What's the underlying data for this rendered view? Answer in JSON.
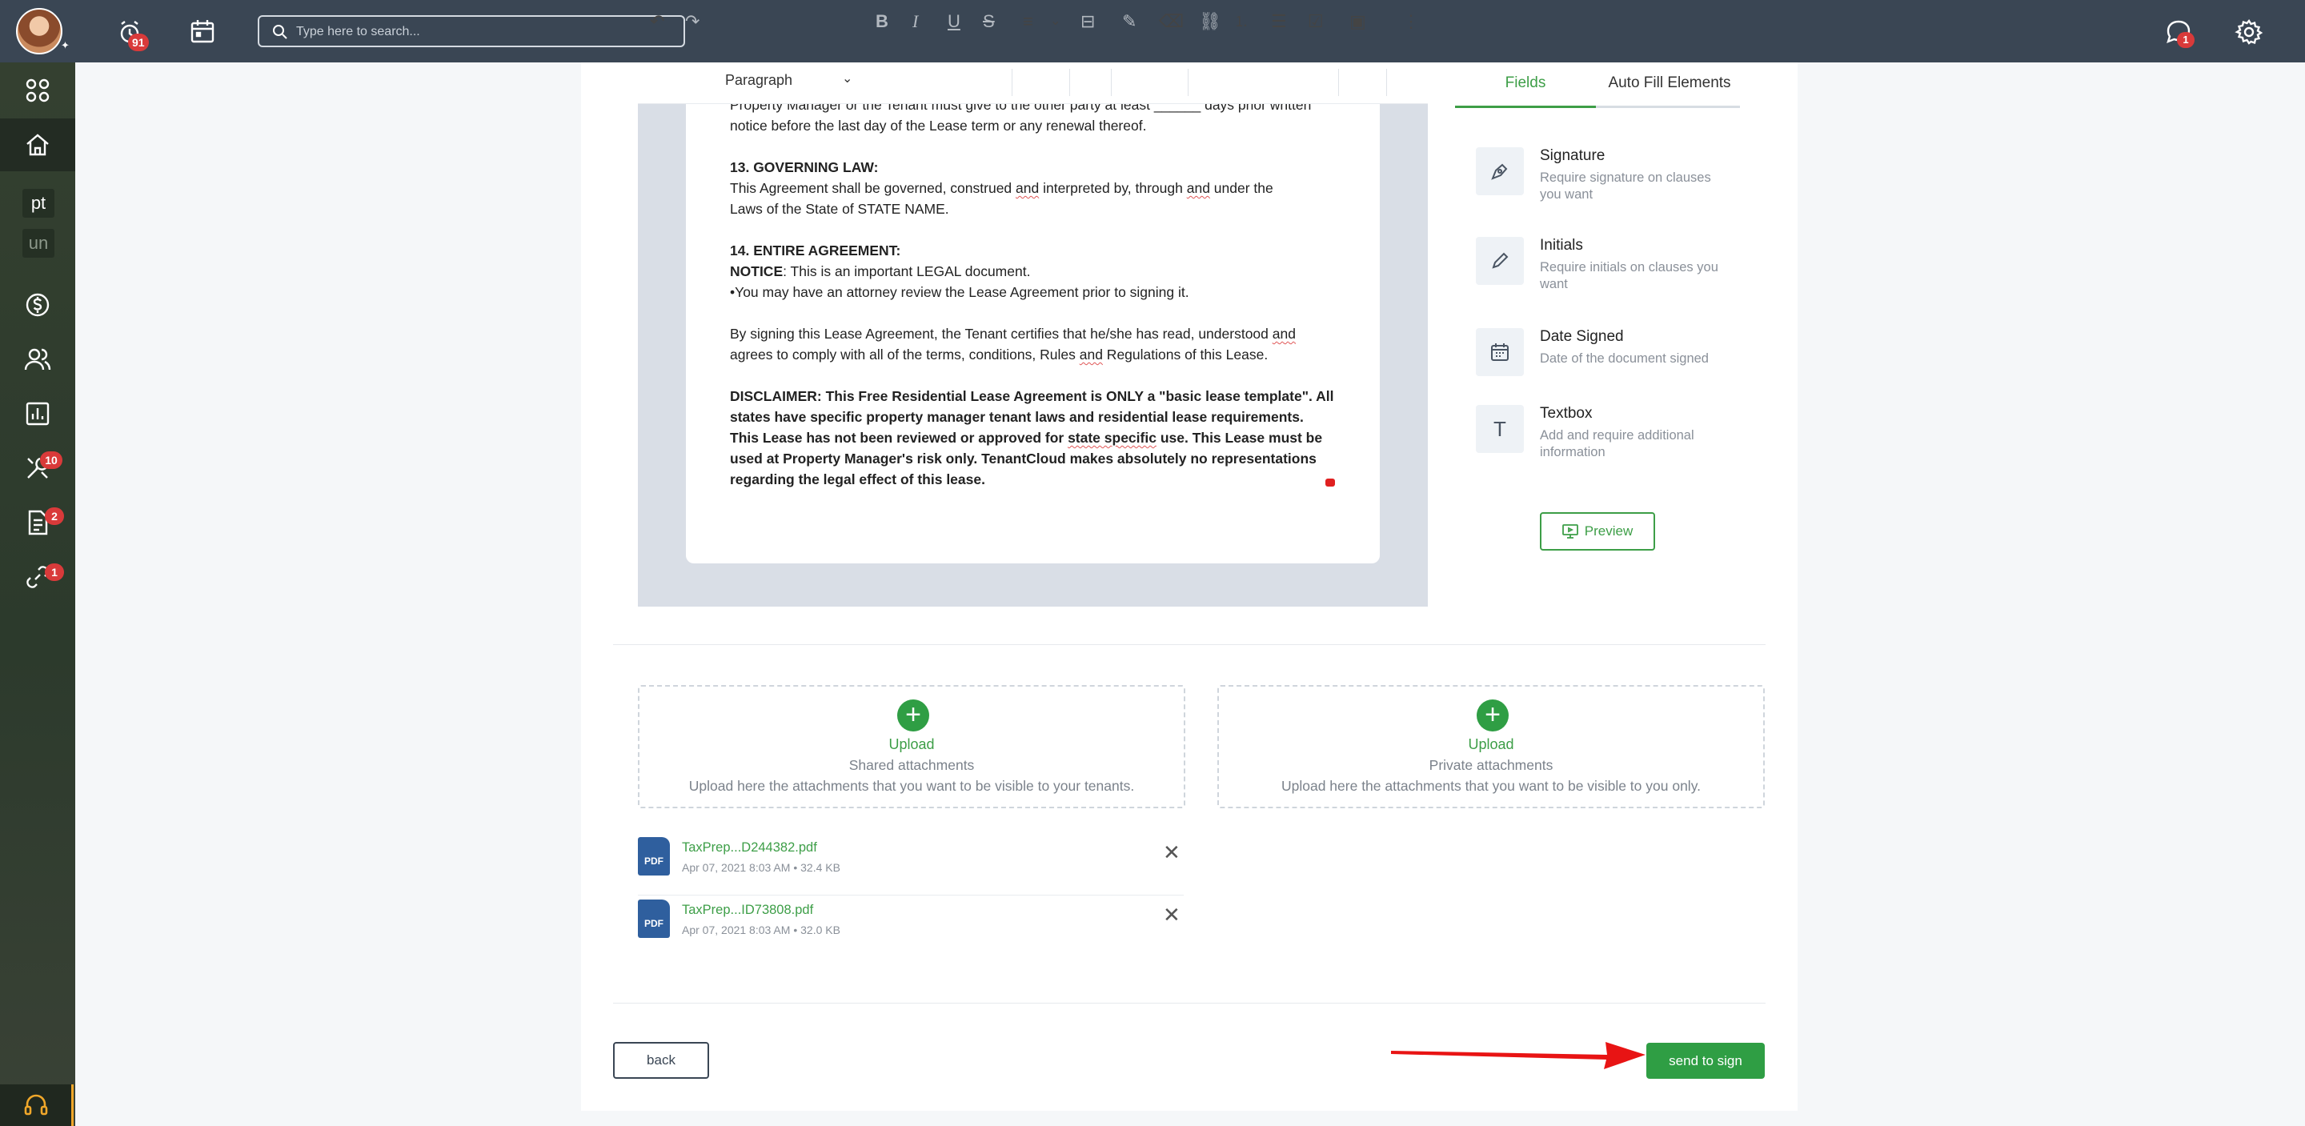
{
  "header": {
    "search_placeholder": "Type here to search...",
    "notifications_badge": "91",
    "messages_badge": "1"
  },
  "sidebar": {
    "tags": [
      "pt",
      "un"
    ],
    "maintenance_badge": "10",
    "applications_badge": "2",
    "links_badge": "1"
  },
  "toolbar": {
    "paragraph_style": "Paragraph"
  },
  "document": {
    "line_top": "Property Manager or the Tenant must give to the other party at least ______ days prior written",
    "line_top2": "notice before the last day of the Lease term or any renewal thereof.",
    "s13_heading": "13. GOVERNING LAW:",
    "s13_l1_a": "This Agreement shall be governed, construed ",
    "s13_and1": "and",
    "s13_l1_b": " interpreted by, through ",
    "s13_and2": "and",
    "s13_l1_c": " under the",
    "s13_l2": "Laws of the State of STATE NAME.",
    "s14_heading": "14. ENTIRE AGREEMENT:",
    "notice_label": "NOTICE",
    "notice_text": ": This is an important LEGAL document.",
    "attorney_line": "•You may have an attorney review the Lease Agreement prior to signing it.",
    "signing_l1_a": "By signing this Lease Agreement, the Tenant certifies that he/she has read, understood ",
    "signing_and": "and",
    "signing_l2_a": "agrees to comply with all of the terms, conditions, Rules ",
    "signing_and2": "and",
    "signing_l2_b": " Regulations of this Lease.",
    "disclaimer_l1": "DISCLAIMER: This Free Residential Lease Agreement is ONLY a \"basic lease template\". All",
    "disclaimer_l2": "states have specific property manager tenant laws and residential lease requirements.",
    "disclaimer_l3_a": "This Lease has not been reviewed or approved for ",
    "disclaimer_l3_sq": "state specific",
    "disclaimer_l3_b": " use. This Lease must be",
    "disclaimer_l4": "used at Property Manager's risk only. TenantCloud makes absolutely no representations",
    "disclaimer_l5": "regarding the legal effect of this lease."
  },
  "fields_panel": {
    "tabs": [
      "Fields",
      "Auto Fill Elements"
    ],
    "items": [
      {
        "title": "Signature",
        "desc": "Require signature on clauses you want",
        "icon": "pen-nib-icon"
      },
      {
        "title": "Initials",
        "desc": "Require initials on clauses you want",
        "icon": "pencil-icon"
      },
      {
        "title": "Date Signed",
        "desc": "Date of the document signed",
        "icon": "calendar-icon"
      },
      {
        "title": "Textbox",
        "desc": "Add and require additional information",
        "icon": "text-t-icon"
      }
    ],
    "preview_label": "Preview"
  },
  "uploads": [
    {
      "title": "Upload",
      "kind": "Shared attachments",
      "desc": "Upload here the attachments that you want to be visible to your tenants."
    },
    {
      "title": "Upload",
      "kind": "Private attachments",
      "desc": "Upload here the attachments that you want to be visible to you only."
    }
  ],
  "files": [
    {
      "name": "TaxPrep...D244382.pdf",
      "date": "Apr 07, 2021 8:03 AM",
      "size": "32.4 KB",
      "icon_label": "PDF"
    },
    {
      "name": "TaxPrep...ID73808.pdf",
      "date": "Apr 07, 2021 8:03 AM",
      "size": "32.0 KB",
      "icon_label": "PDF"
    }
  ],
  "footer": {
    "back_label": "back",
    "send_label": "send to sign"
  },
  "colors": {
    "accent_green": "#2f9e44",
    "topbar": "#3a4654",
    "badge_red": "#d93a3a"
  }
}
